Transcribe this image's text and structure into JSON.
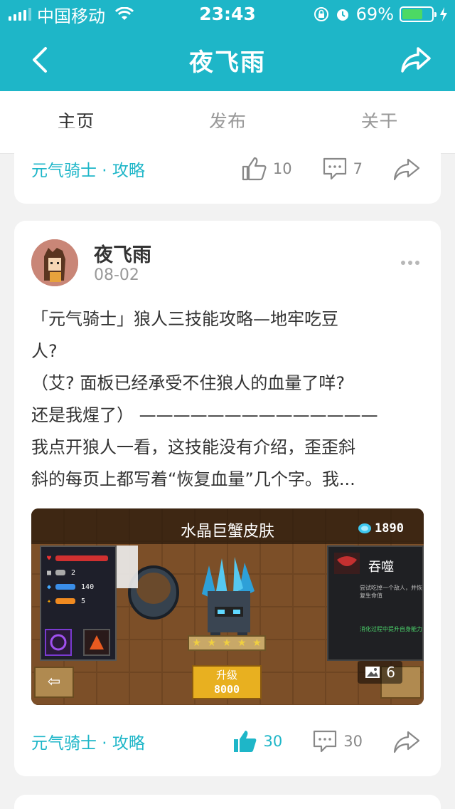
{
  "status_bar": {
    "carrier": "中国移动",
    "time": "23:43",
    "battery_percent": "69%",
    "battery_level": 0.69
  },
  "nav": {
    "title": "夜飞雨",
    "back_icon": "chevron-left-icon",
    "share_icon": "share-icon"
  },
  "tabs": [
    {
      "label": "主页",
      "active": true
    },
    {
      "label": "发布",
      "active": false
    },
    {
      "label": "关于",
      "active": false
    }
  ],
  "post_top": {
    "tag": "元气骑士 · 攻略",
    "likes": "10",
    "comments": "7"
  },
  "post": {
    "author": "夜飞雨",
    "date": "08-02",
    "lines": [
      "「元气骑士」狼人三技能攻略—地牢吃豆",
      "人?",
      "（艾? 面板已经承受不住狼人的血量了咩?",
      "还是我煋了）  ——————————————",
      "我点开狼人一看，这技能没有介绍，歪歪斜",
      "斜的每页上都写着“恢复血量”几个字。我..."
    ],
    "image": {
      "title": "水晶巨蟹皮肤",
      "gems": "1890",
      "skill_name": "吞噬",
      "skill_desc": "尝试吃掉一个敌人，并恢复生命值",
      "skill_note": "消化过程中提升自身能力",
      "upgrade_label": "升级",
      "upgrade_cost": "8000",
      "stat_values": [
        "2",
        "140",
        "5"
      ],
      "image_count": "6"
    },
    "tag": "元气骑士 · 攻略",
    "likes": "30",
    "comments": "30"
  },
  "colors": {
    "accent": "#1eb6c8",
    "battery": "#4cd964"
  }
}
